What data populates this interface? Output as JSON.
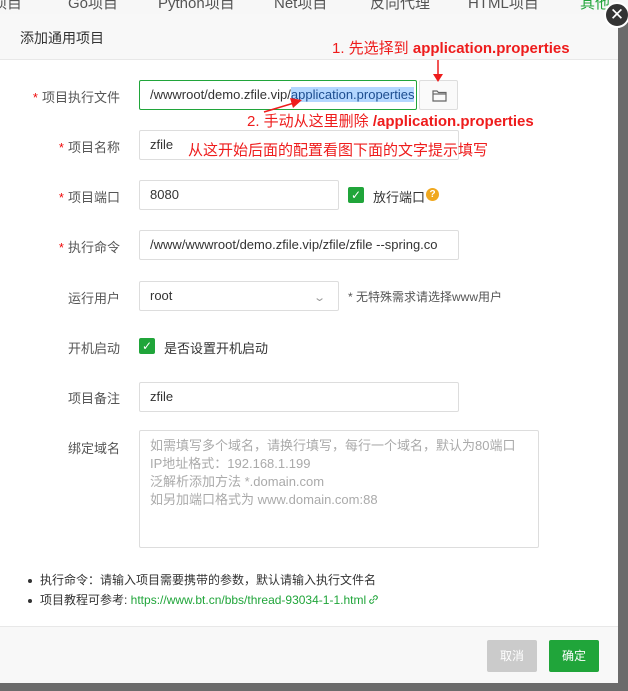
{
  "background_tabs": [
    "项目",
    "Go项目",
    "Python项目",
    "Net项目",
    "反向代理",
    "HTML项目",
    "其他"
  ],
  "dialog": {
    "title": "添加通用项目",
    "close_glyph": "✕"
  },
  "form": {
    "exec_file": {
      "label": "项目执行文件",
      "value_prefix": "/wwwroot/demo.zfile.vip/",
      "value_selected": "application.properties"
    },
    "name": {
      "label": "项目名称",
      "value": "zfile"
    },
    "port": {
      "label": "项目端口",
      "value": "8080",
      "checkbox_label": "放行端口",
      "help_glyph": "?"
    },
    "command": {
      "label": "执行命令",
      "value": "/www/wwwroot/demo.zfile.vip/zfile/zfile --spring.co"
    },
    "run_user": {
      "label": "运行用户",
      "value": "root",
      "hint": "* 无特殊需求请选择www用户"
    },
    "autostart": {
      "label": "开机启动",
      "checkbox_label": "是否设置开机启动"
    },
    "remark": {
      "label": "项目备注",
      "value": "zfile"
    },
    "domain": {
      "label": "绑定域名",
      "placeholder_lines": [
        "如需填写多个域名，请换行填写，每行一个域名，默认为80端口",
        "IP地址格式：192.168.1.199",
        "泛解析添加方法 *.domain.com",
        "如另加端口格式为 www.domain.com:88"
      ]
    },
    "required_mark": "*"
  },
  "tips": {
    "line1": "执行命令：请输入项目需要携带的参数，默认请输入执行文件名",
    "line2_prefix": "项目教程可参考: ",
    "line2_link": "https://www.bt.cn/bbs/thread-93034-1-1.html"
  },
  "footer": {
    "cancel": "取消",
    "confirm": "确定"
  },
  "annotations": {
    "step1_prefix": "1. 先选择到 ",
    "step1_bold": "application.properties",
    "step2_prefix": "2. 手动从这里删除 ",
    "step2_bold": "/application.properties",
    "note": "从这开始后面的配置看图下面的文字提示填写",
    "color": "#ee1c1c"
  },
  "colors": {
    "accent": "#20a53a",
    "required": "#ef0808",
    "help": "#f0a81f"
  },
  "icons": {
    "folder": "folder-icon",
    "close": "close-icon",
    "chevron": "chevron-down-icon",
    "link": "link-icon",
    "check": "check-icon"
  }
}
